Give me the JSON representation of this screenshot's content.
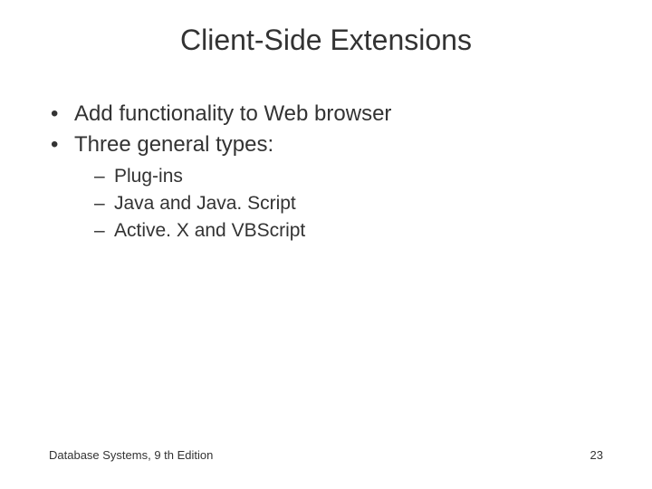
{
  "title": "Client-Side Extensions",
  "bullets": [
    {
      "text": "Add functionality to Web browser"
    },
    {
      "text": "Three general types:"
    }
  ],
  "sub_bullets": [
    {
      "text": "Plug-ins"
    },
    {
      "text": "Java and Java. Script"
    },
    {
      "text": "Active. X and VBScript"
    }
  ],
  "footer": {
    "source": "Database Systems, 9 th Edition",
    "page": "23"
  },
  "glyphs": {
    "bullet": "•",
    "dash": "–"
  }
}
